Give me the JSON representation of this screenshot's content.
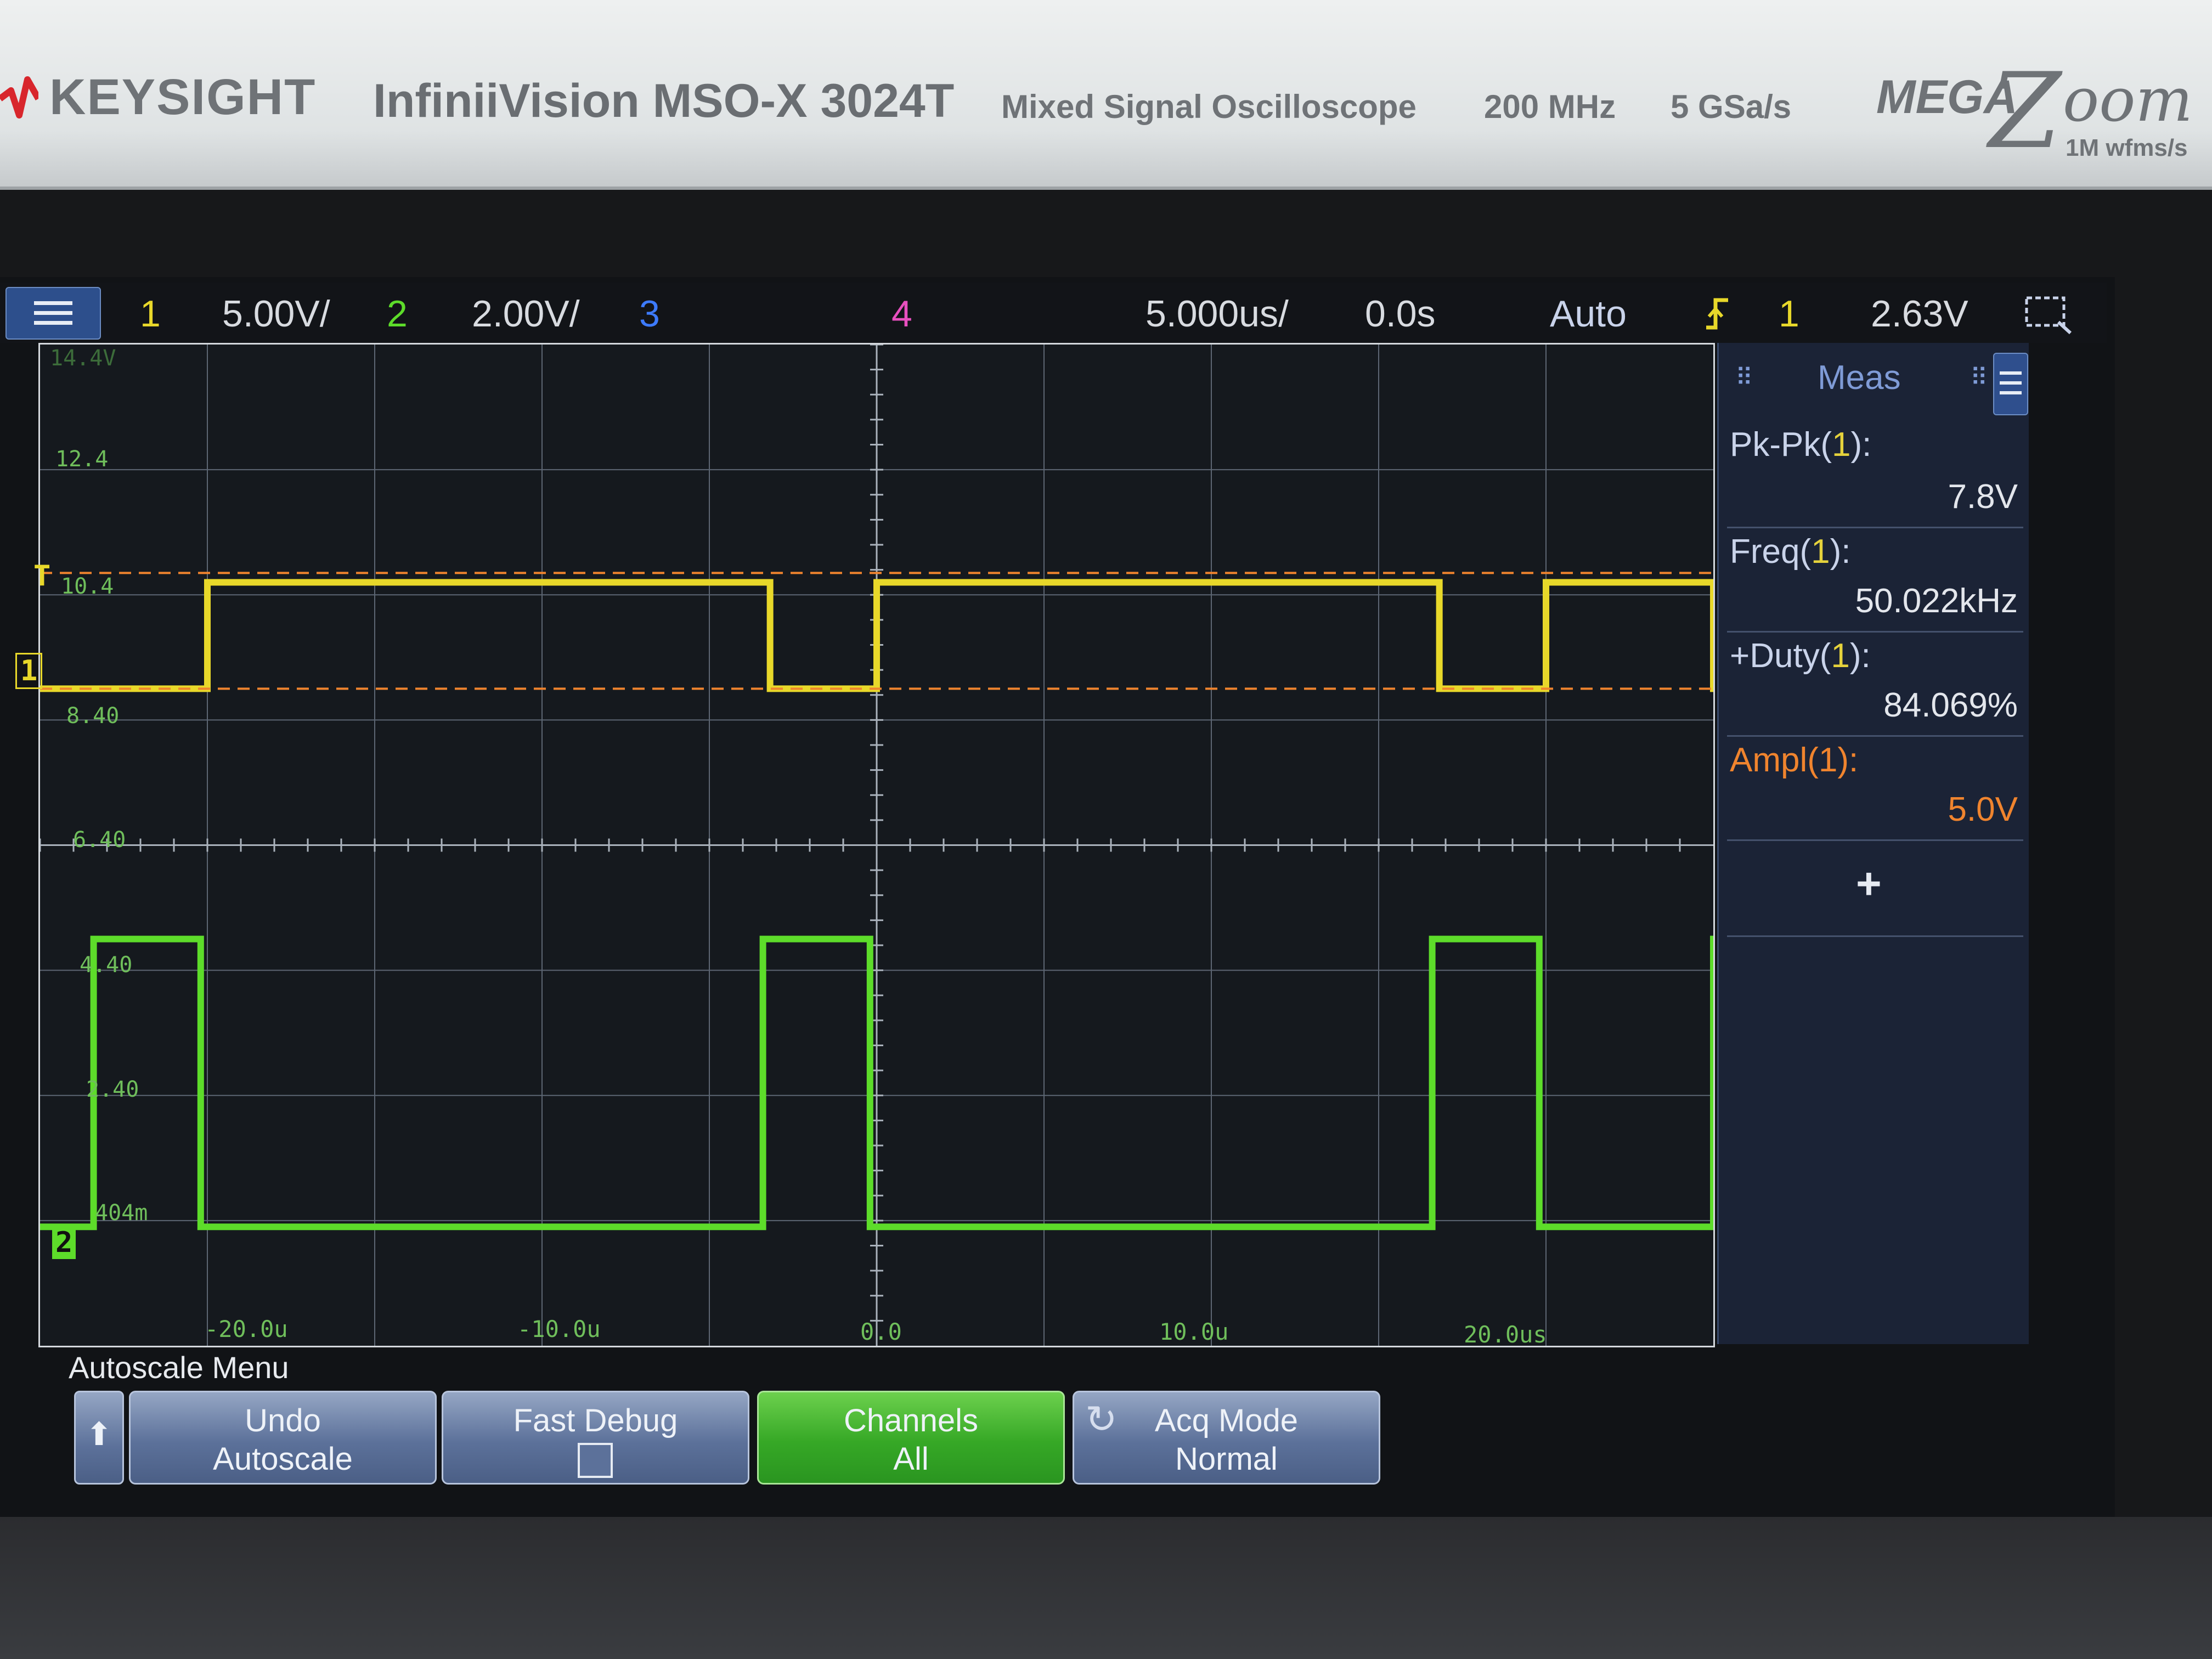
{
  "instrument": {
    "brand": "KEYSIGHT",
    "model": "InfiniiVision MSO-X 3024T",
    "description": "Mixed Signal Oscilloscope",
    "bandwidth": "200 MHz",
    "sample_rate": "5 GSa/s",
    "megazoom": {
      "mega": "MEGA",
      "z": "Z",
      "oom": "oom",
      "sub": "1M wfms/s"
    }
  },
  "status_bar": {
    "ch1_num": "1",
    "ch1_scale": "5.00V/",
    "ch2_num": "2",
    "ch2_scale": "2.00V/",
    "ch3_num": "3",
    "ch4_num": "4",
    "timebase": "5.000us/",
    "delay": "0.0s",
    "trigger_mode": "Auto",
    "trigger_icon": "trigger-edge-icon",
    "trigger_source": "1",
    "trigger_level": "2.63V"
  },
  "graticule": {
    "y_labels": [
      "14.4V",
      "12.4",
      "10.4",
      "8.40",
      "6.40",
      "4.40",
      "2.40",
      "404m"
    ],
    "x_labels": [
      "-20.0u",
      "-10.0u",
      "0.0",
      "10.0u",
      "20.0us"
    ],
    "markers": {
      "trigger": "T",
      "ch1": "1",
      "ch2": "2"
    }
  },
  "measurements": {
    "title": "Meas",
    "items": [
      {
        "label": "Pk-Pk(",
        "ch": "1",
        "suffix": "):",
        "value": "7.8V"
      },
      {
        "label": "Freq(",
        "ch": "1",
        "suffix": "):",
        "value": "50.022kHz"
      },
      {
        "label": "+Duty(",
        "ch": "1",
        "suffix": "):",
        "value": "84.069%"
      },
      {
        "label": "Ampl(",
        "ch": "1",
        "suffix": "):",
        "value": "5.0V"
      }
    ],
    "add": "+"
  },
  "softkeys": {
    "menu_title": "Autoscale Menu",
    "back": "⬆",
    "undo": {
      "l1": "Undo",
      "l2": "Autoscale"
    },
    "fast_debug": {
      "l1": "Fast Debug"
    },
    "channels": {
      "l1": "Channels",
      "l2": "All"
    },
    "acq_mode": {
      "l1": "Acq Mode",
      "l2": "Normal"
    }
  },
  "colors": {
    "ch1": "#e8d82a",
    "ch2": "#5ddc2a",
    "ch3": "#3d7bff",
    "ch4": "#e84fbf",
    "trigger_level": "#f0842e",
    "ampl_highlight": "#f0842e"
  },
  "waveforms": {
    "time_per_div_us": 5,
    "ch1": {
      "high_v": 10.6,
      "low_v": 8.9,
      "period_us": 20.0,
      "duty": 0.84069
    },
    "ch2": {
      "high_v": 4.9,
      "low_v": 0.3,
      "period_us": 20.0,
      "duty": 0.16
    }
  }
}
